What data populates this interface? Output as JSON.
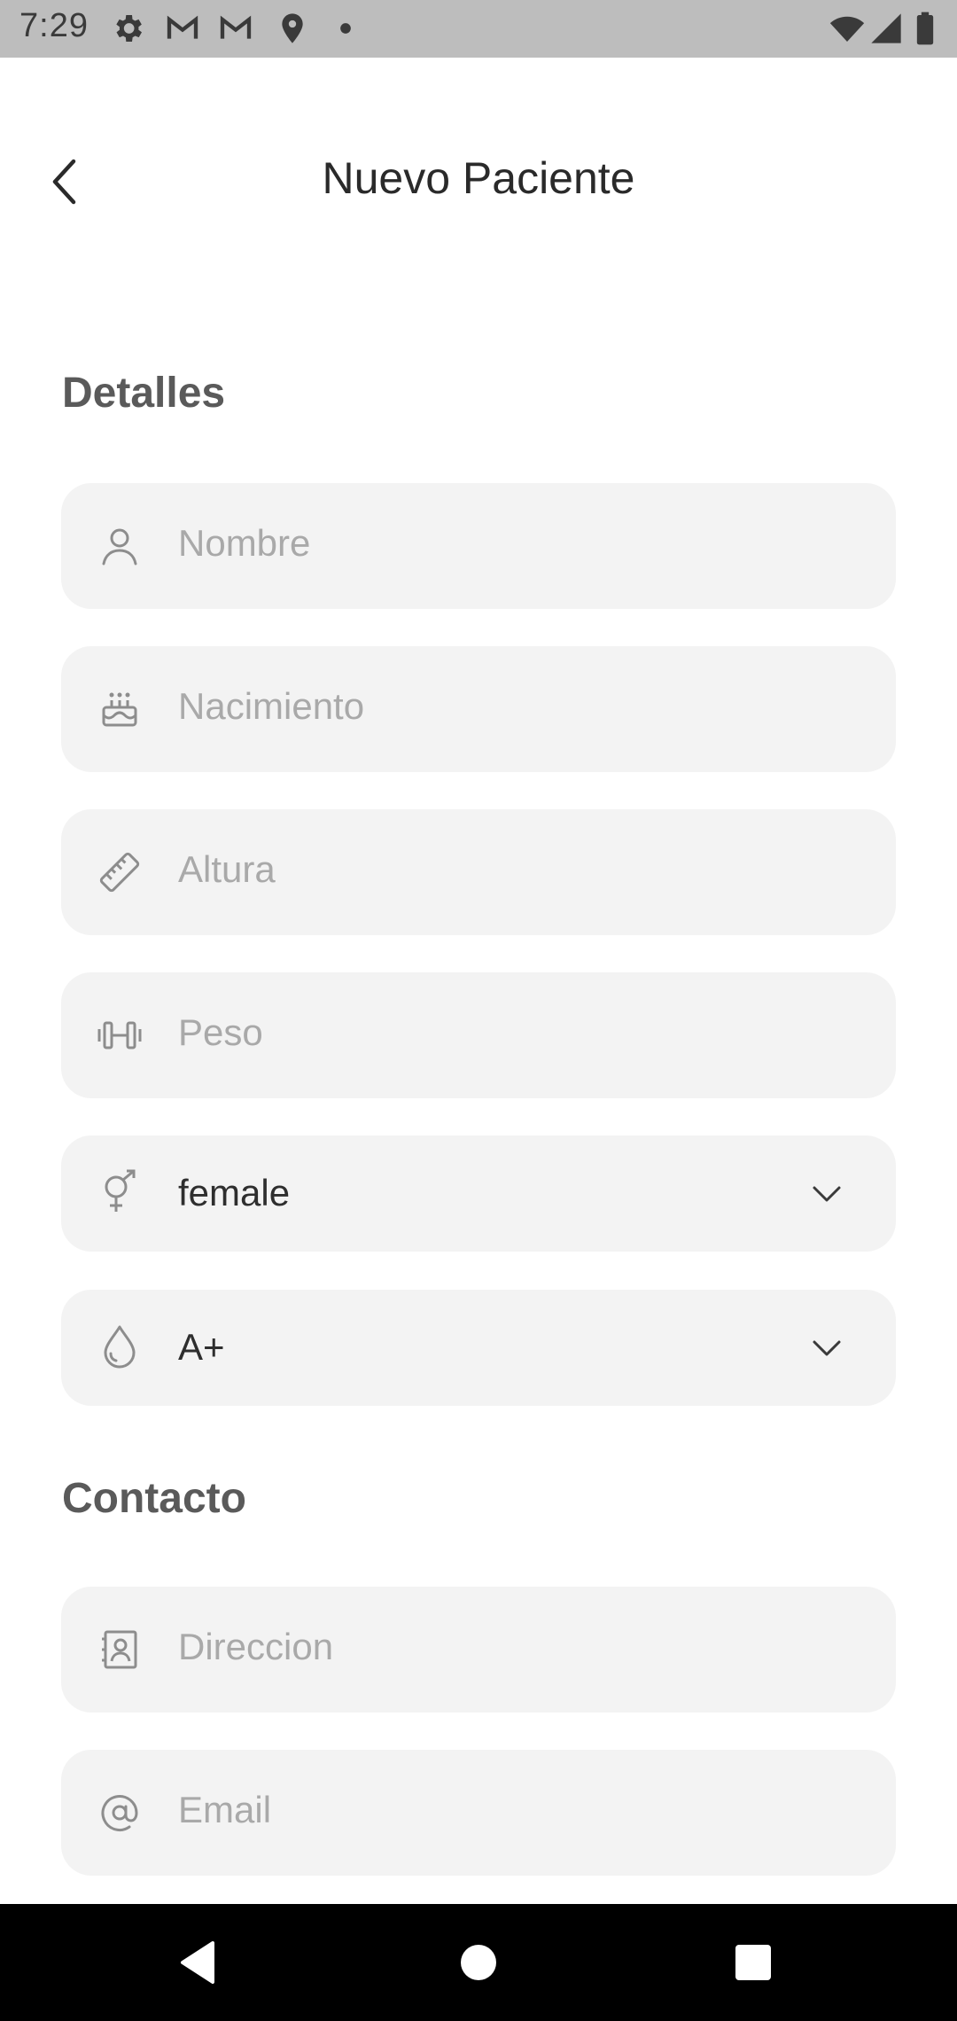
{
  "status_bar": {
    "time": "7:29",
    "icons": [
      "gear-icon",
      "gmail-icon",
      "gmail-icon",
      "location-icon",
      "dot-icon",
      "wifi-icon",
      "signal-icon",
      "battery-icon"
    ]
  },
  "header": {
    "title": "Nuevo Paciente",
    "back_icon": "chevron-left-icon"
  },
  "sections": {
    "details_title": "Detalles",
    "contact_title": "Contacto"
  },
  "fields": {
    "nombre": {
      "placeholder": "Nombre",
      "icon": "person-icon"
    },
    "nacimiento": {
      "placeholder": "Nacimiento",
      "icon": "cake-icon"
    },
    "altura": {
      "placeholder": "Altura",
      "icon": "ruler-icon"
    },
    "peso": {
      "placeholder": "Peso",
      "icon": "dumbbell-icon"
    },
    "gender": {
      "value": "female",
      "icon": "gender-icon"
    },
    "blood": {
      "value": "A+",
      "icon": "drop-icon"
    },
    "direccion": {
      "placeholder": "Direccion",
      "icon": "contact-card-icon"
    },
    "email": {
      "placeholder": "Email",
      "icon": "at-icon"
    }
  },
  "nav_bar": {
    "buttons": [
      "back-triangle-icon",
      "home-circle-icon",
      "recents-square-icon"
    ]
  },
  "colors": {
    "field_bg": "#f3f3f3",
    "placeholder": "#a9a9a9",
    "section_title": "#5a5a5a",
    "status_bar_bg": "#bdbdbd"
  }
}
